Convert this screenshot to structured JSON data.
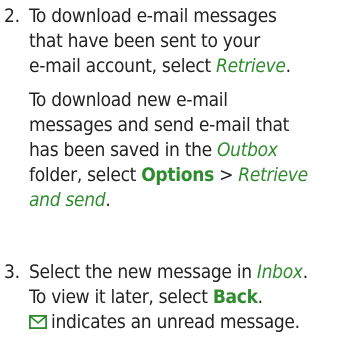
{
  "step2": {
    "number": "2.",
    "p1": {
      "l1": "To download e-mail messages",
      "l2": "that have been sent to your",
      "l3_pre": "e-mail account, select ",
      "l3_retrieve": "Retrieve",
      "l3_post": "."
    },
    "p2": {
      "l1": "To download new e-mail",
      "l2": "messages and send e-mail that",
      "l3": "has been saved in the ",
      "l3_outbox": "Outbox",
      "l4_pre": "folder, select ",
      "l4_options": "Options",
      "l4_gt": " > ",
      "l4_retrieve": "Retrieve",
      "l5_andsend": "and send",
      "l5_post": "."
    }
  },
  "step3": {
    "number": "3.",
    "l1_pre": "Select the new message in ",
    "l1_inbox": "Inbox",
    "l1_post": ".",
    "l2_pre": "To view it later, select ",
    "l2_back": "Back",
    "l2_post": ".",
    "icon": "envelope-icon",
    "l3": "indicates an unread message."
  },
  "colors": {
    "text": "#222222",
    "accent": "#2e8b2e"
  }
}
